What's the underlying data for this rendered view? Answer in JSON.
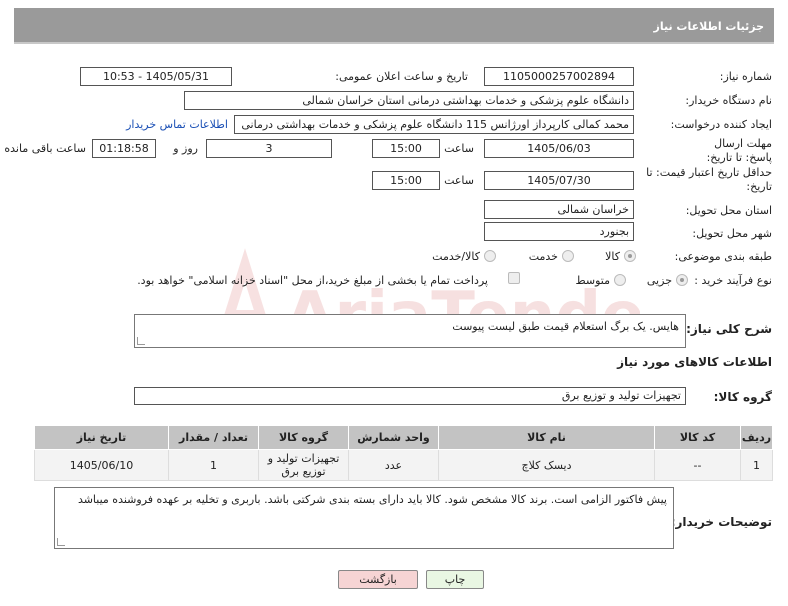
{
  "header": {
    "title": "جزئیات اطلاعات نیاز"
  },
  "fields": {
    "need_number_label": "شماره نیاز:",
    "need_number": "1105000257002894",
    "announce_label": "تاریخ و ساعت اعلان عمومی:",
    "announce_value": "1405/05/31 - 10:53",
    "buyer_org_label": "نام دستگاه خریدار:",
    "buyer_org": "دانشگاه علوم پزشکی و خدمات بهداشتی درمانی استان خراسان شمالی",
    "creator_label": "ایجاد کننده درخواست:",
    "creator": "محمد کمالی کارپرداز اورژانس 115 دانشگاه علوم پزشکی و خدمات بهداشتی درمانی",
    "contact_link": "اطلاعات تماس خریدار",
    "reply_deadline_label": "مهلت ارسال پاسخ: تا تاریخ:",
    "reply_date": "1405/06/03",
    "time_label": "ساعت",
    "reply_time": "15:00",
    "days_value": "3",
    "days_label": "روز و",
    "remaining_time": "01:18:58",
    "remaining_label": "ساعت باقی مانده",
    "price_validity_label": "حداقل تاریخ اعتبار قیمت: تا تاریخ:",
    "price_date": "1405/07/30",
    "price_time": "15:00",
    "province_label": "استان محل تحویل:",
    "province": "خراسان شمالی",
    "city_label": "شهر محل تحویل:",
    "city": "بجنورد",
    "category_label": "طبقه بندی موضوعی:",
    "category_options": [
      "کالا",
      "خدمت",
      "کالا/خدمت"
    ],
    "category_selected": 0,
    "purchase_type_label": "نوع فرآیند خرید :",
    "purchase_options": [
      "جزیی",
      "متوسط"
    ],
    "purchase_selected": 0,
    "treasury_note": "پرداخت تمام یا بخشی از مبلغ خرید،از محل \"اسناد خزانه اسلامی\" خواهد بود.",
    "summary_label": "شرح کلی نیاز:",
    "summary": "هایس. یک برگ استعلام قیمت طبق لیست پیوست"
  },
  "goods_section": {
    "title": "اطلاعات کالاهای مورد نیاز",
    "group_label": "گروه کالا:",
    "group_value": "تجهیزات تولید و توزیع برق"
  },
  "table": {
    "headers": [
      "ردیف",
      "کد کالا",
      "نام کالا",
      "واحد شمارش",
      "گروه کالا",
      "تعداد / مقدار",
      "تاریخ نیاز"
    ],
    "rows": [
      [
        "1",
        "--",
        "دیسک کلاچ",
        "عدد",
        "تجهیزات تولید و توزیع برق",
        "1",
        "1405/06/10"
      ]
    ]
  },
  "buyer_notes": {
    "label": "توضیحات خریدار:",
    "text": "پیش فاکتور الزامی است. برند کالا مشخص شود. کالا باید دارای بسته بندی شرکتی باشد. باربری  و تخلیه بر عهده فروشنده میباشد"
  },
  "buttons": {
    "print": "چاپ",
    "back": "بازگشت"
  },
  "colors": {
    "header_bg": "#9a9a9a",
    "back_button_bg": "#f6d4d4",
    "print_button_bg": "#e9f7e3",
    "link": "#1a4fb5"
  },
  "watermark": {
    "text": "AriaTender.net"
  }
}
